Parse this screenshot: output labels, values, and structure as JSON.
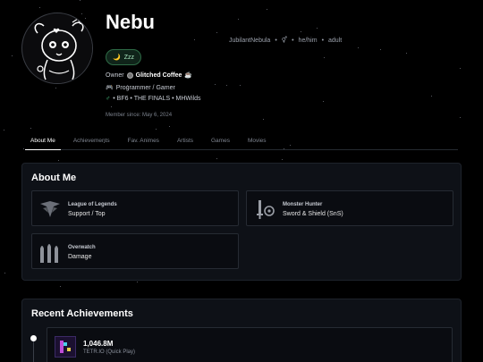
{
  "profile": {
    "name": "Nebu",
    "username": "JubilantNebula",
    "gender_symbol": "⚥",
    "pronouns": "he/him",
    "age": "adult",
    "status": "Zzz",
    "owner_prefix": "Owner",
    "owner_name": "Glitched Coffee",
    "roles": "Programmer / Gamer",
    "games_line": "• BF6 • THE FINALS • MHWilds",
    "member_since": "Member since: May 6, 2024"
  },
  "tabs": [
    "About Me",
    "Achievements",
    "Fav. Animes",
    "Artists",
    "Games",
    "Movies"
  ],
  "about": {
    "title": "About Me",
    "games": [
      {
        "name": "League of Legends",
        "role": "Support / Top",
        "icon": "lol-icon"
      },
      {
        "name": "Monster Hunter",
        "role": "Sword & Shield (SnS)",
        "icon": "sword-shield-icon"
      },
      {
        "name": "Overwatch",
        "role": "Damage",
        "icon": "overwatch-icon"
      }
    ]
  },
  "achievements": {
    "title": "Recent Achievements",
    "items": [
      {
        "score": "1,046.8M",
        "game": "TETR.IO (Quick Play)"
      }
    ]
  },
  "colors": {
    "background": "#000000",
    "card": "#0e1117",
    "accent_green": "#2e6b46"
  }
}
